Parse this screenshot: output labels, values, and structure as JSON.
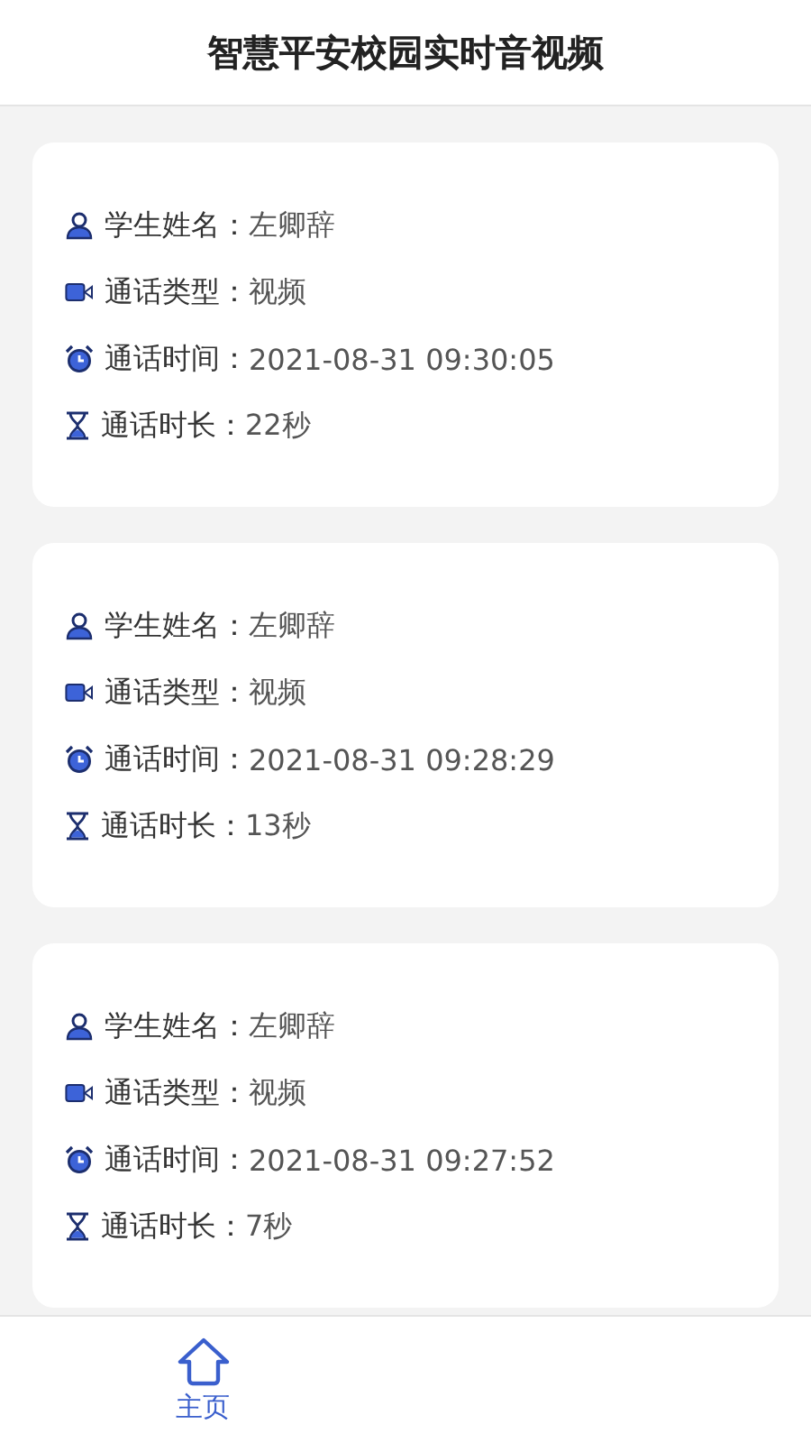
{
  "header": {
    "title": "智慧平安校园实时音视频"
  },
  "records": [
    {
      "fields": [
        {
          "kind": "student",
          "label": "学生姓名：",
          "value": "左卿辞"
        },
        {
          "kind": "type",
          "label": "通话类型：",
          "value": "视频"
        },
        {
          "kind": "time",
          "label": "通话时间：",
          "value": "2021-08-31 09:30:05"
        },
        {
          "kind": "duration",
          "label": "通话时长：",
          "value": "22秒"
        }
      ]
    },
    {
      "fields": [
        {
          "kind": "student",
          "label": "学生姓名：",
          "value": "左卿辞"
        },
        {
          "kind": "type",
          "label": "通话类型：",
          "value": "视频"
        },
        {
          "kind": "time",
          "label": "通话时间：",
          "value": "2021-08-31 09:28:29"
        },
        {
          "kind": "duration",
          "label": "通话时长：",
          "value": "13秒"
        }
      ]
    },
    {
      "fields": [
        {
          "kind": "student",
          "label": "学生姓名：",
          "value": "左卿辞"
        },
        {
          "kind": "type",
          "label": "通话类型：",
          "value": "视频"
        },
        {
          "kind": "time",
          "label": "通话时间：",
          "value": "2021-08-31 09:27:52"
        },
        {
          "kind": "duration",
          "label": "通话时长：",
          "value": "7秒"
        }
      ]
    }
  ],
  "tabs": [
    {
      "label": "主页",
      "selected": true
    }
  ]
}
